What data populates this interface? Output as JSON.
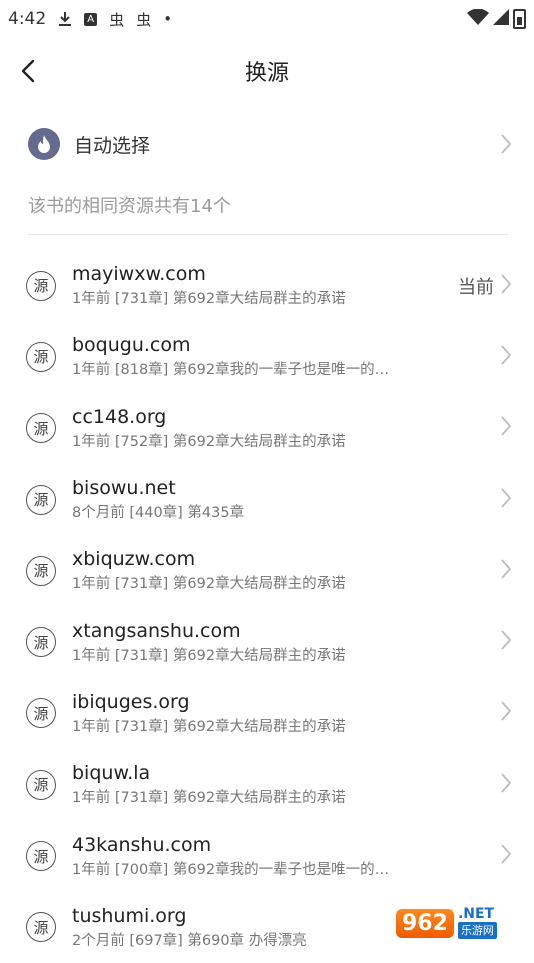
{
  "status_bar": {
    "time": "4:42",
    "glyph_a": "A",
    "glyph_c1": "虫",
    "glyph_c2": "虫",
    "dot": "•"
  },
  "header": {
    "title": "换源"
  },
  "auto_select": {
    "label": "自动选择"
  },
  "section_caption": "该书的相同资源共有14个",
  "sources": [
    {
      "domain": "mayiwxw.com",
      "sub": "1年前 [731章] 第692章大结局群主的承诺",
      "current": "当前"
    },
    {
      "domain": "boqugu.com",
      "sub": "1年前 [818章] 第692章我的一辈子也是唯一的…"
    },
    {
      "domain": "cc148.org",
      "sub": "1年前 [752章] 第692章大结局群主的承诺"
    },
    {
      "domain": "bisowu.net",
      "sub": "8个月前 [440章] 第435章"
    },
    {
      "domain": "xbiquzw.com",
      "sub": "1年前 [731章] 第692章大结局群主的承诺"
    },
    {
      "domain": "xtangsanshu.com",
      "sub": "1年前 [731章] 第692章大结局群主的承诺"
    },
    {
      "domain": "ibiquges.org",
      "sub": "1年前 [731章] 第692章大结局群主的承诺"
    },
    {
      "domain": "biquw.la",
      "sub": "1年前 [731章] 第692章大结局群主的承诺"
    },
    {
      "domain": "43kanshu.com",
      "sub": "1年前 [700章] 第692章我的一辈子也是唯一的…"
    },
    {
      "domain": "tushumi.org",
      "sub": "2个月前 [697章] 第690章 办得漂亮"
    }
  ],
  "source_icon_glyph": "源",
  "watermark": {
    "badge": "962",
    "net": ".NET",
    "cn": "乐游网"
  }
}
